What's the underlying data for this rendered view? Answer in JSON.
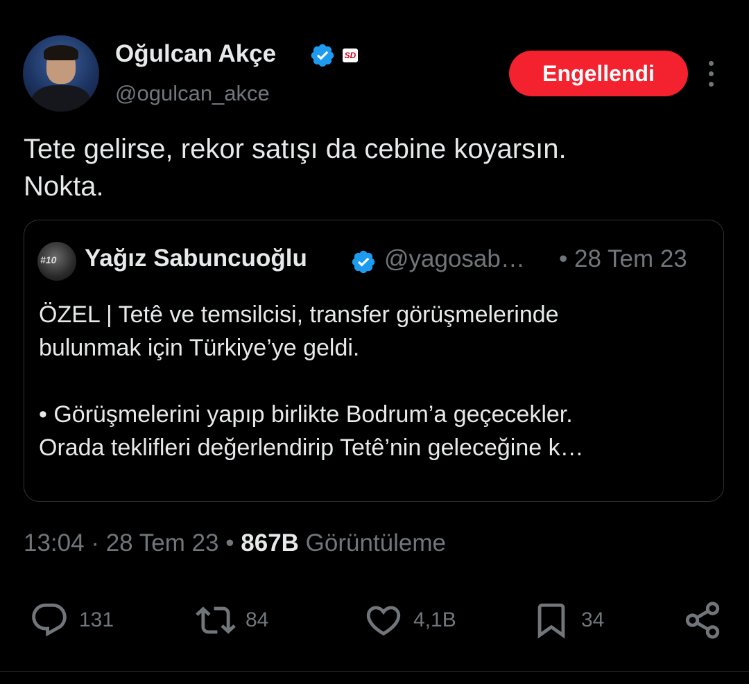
{
  "author": {
    "name": "Oğulcan Akçe",
    "handle": "@ogulcan_akce",
    "badge_text": "SD"
  },
  "block_button": {
    "label": "Engellendi",
    "color": "#f4212e"
  },
  "tweet": {
    "lines": [
      "Tete gelirse, rekor satışı da cebine koyarsın.",
      "Nokta."
    ]
  },
  "quote": {
    "avatar_text": "#10",
    "name": "Yağız Sabuncuoğlu",
    "handle": "@yagosab…",
    "date": "• 28 Tem 23",
    "lines": [
      "ÖZEL | Tetê ve temsilcisi, transfer görüşmelerinde",
      "bulunmak için Türkiye’ye geldi.",
      "",
      "• Görüşmelerini yapıp birlikte Bodrum’a geçecekler.",
      "Orada teklifleri değerlendirip Tetê’nin geleceğine k…"
    ]
  },
  "meta": {
    "time": "13:04",
    "sep1": "·",
    "date": "28 Tem 23",
    "sep2": "•",
    "views": "867B",
    "views_label": "Görüntüleme"
  },
  "actions": {
    "reply_count": "131",
    "retweet_count": "84",
    "like_count": "4,1B",
    "bookmark_count": "34"
  },
  "colors": {
    "background": "#000000",
    "text": "#e7e9ea",
    "muted": "#71767b",
    "verified": "#1d9bf0",
    "border": "#2f3336"
  },
  "icons": [
    "verified-badge-icon",
    "more-icon",
    "reply-icon",
    "retweet-icon",
    "like-icon",
    "bookmark-icon",
    "share-icon"
  ]
}
